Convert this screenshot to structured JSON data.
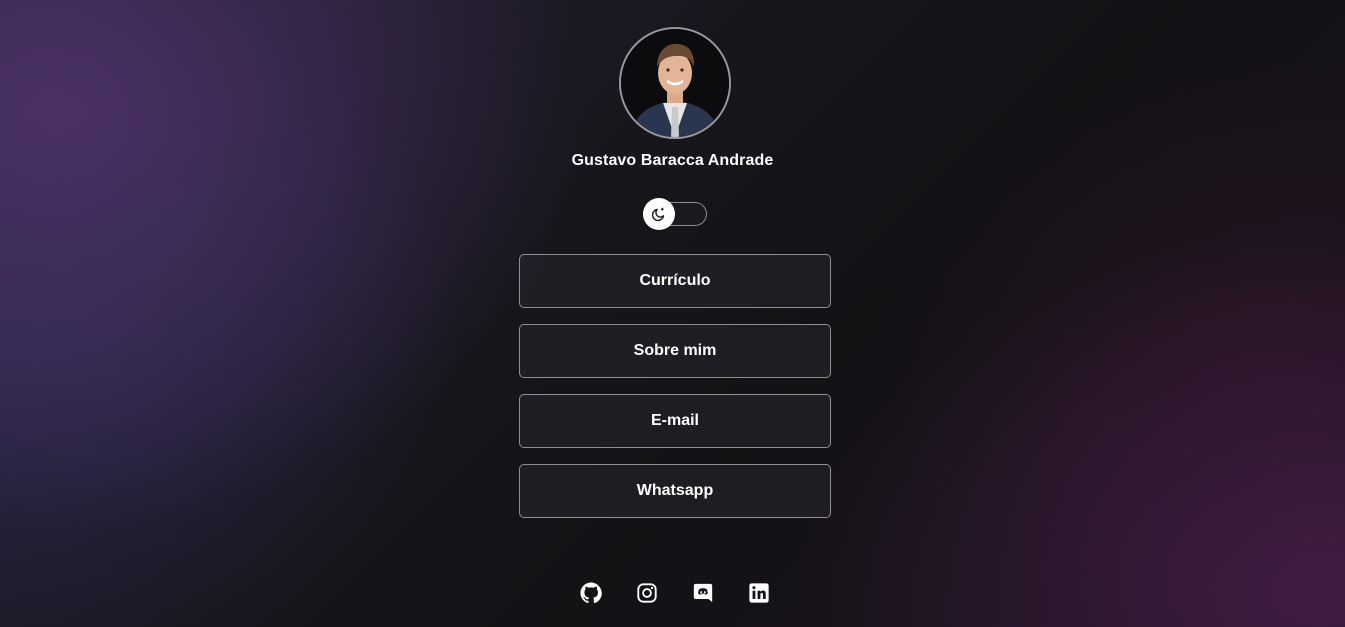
{
  "profile": {
    "name": "Gustavo Baracca Andrade",
    "avatar_icon": "profile-photo"
  },
  "theme_toggle": {
    "icon": "moon-icon",
    "state": "dark"
  },
  "links": [
    {
      "label": "Currículo"
    },
    {
      "label": "Sobre mim"
    },
    {
      "label": "E-mail"
    },
    {
      "label": "Whatsapp"
    }
  ],
  "socials": [
    {
      "icon": "github-icon"
    },
    {
      "icon": "instagram-icon"
    },
    {
      "icon": "discord-icon"
    },
    {
      "icon": "linkedin-icon"
    }
  ],
  "colors": {
    "background": "#141318",
    "accent_purple": "#503470",
    "button_border": "#8f8d96",
    "text": "#ffffff"
  }
}
